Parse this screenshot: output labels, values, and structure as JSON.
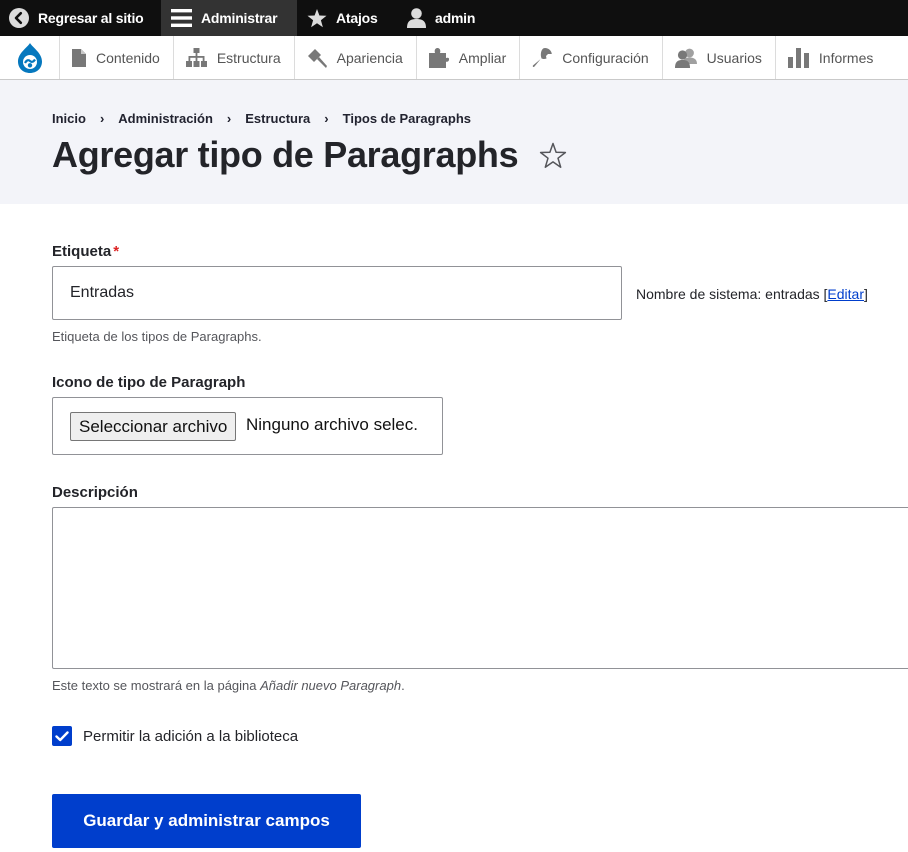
{
  "toolbar": {
    "back_label": "Regresar al sitio",
    "admin_label": "Administrar",
    "shortcuts_label": "Atajos",
    "user_label": "admin"
  },
  "menu": {
    "items": [
      {
        "label": "Contenido",
        "icon": "file-icon"
      },
      {
        "label": "Estructura",
        "icon": "sitemap-icon"
      },
      {
        "label": "Apariencia",
        "icon": "brush-icon"
      },
      {
        "label": "Ampliar",
        "icon": "puzzle-icon"
      },
      {
        "label": "Configuración",
        "icon": "wrench-icon"
      },
      {
        "label": "Usuarios",
        "icon": "users-icon"
      },
      {
        "label": "Informes",
        "icon": "bar-chart-icon"
      }
    ]
  },
  "breadcrumb": [
    "Inicio",
    "Administración",
    "Estructura",
    "Tipos de Paragraphs"
  ],
  "breadcrumb_separator": "›",
  "page_title": "Agregar tipo de Paragraphs",
  "form": {
    "label_field": {
      "label": "Etiqueta",
      "required_mark": "*",
      "value": "Entradas",
      "machine_name_prefix": "Nombre de sistema: entradas",
      "machine_name_edit": "Editar",
      "help": "Etiqueta de los tipos de Paragraphs."
    },
    "icon_field": {
      "label": "Icono de tipo de Paragraph",
      "button_label": "Seleccionar archivo",
      "status": "Ninguno archivo selec."
    },
    "description_field": {
      "label": "Descripción",
      "value": "",
      "help_prefix": "Este texto se mostrará en la página ",
      "help_emphasis": "Añadir nuevo Paragraph",
      "help_suffix": "."
    },
    "library_checkbox": {
      "label": "Permitir la adición a la biblioteca",
      "checked": true
    },
    "submit_label": "Guardar y administrar campos"
  },
  "colors": {
    "toolbar_bg": "#0f0f0f",
    "primary": "#003ecc",
    "header_bg": "#f3f4f9",
    "required": "#dc2323"
  }
}
